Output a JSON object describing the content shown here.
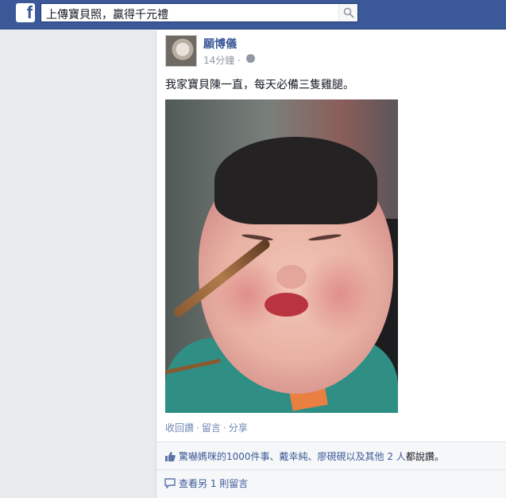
{
  "header": {
    "logo": "f",
    "search_value": "上傳寶貝照，贏得千元禮",
    "search_icon": "search-icon"
  },
  "post": {
    "author": "願博儀",
    "time": "14分鐘",
    "dot": "·",
    "message": "我家寶貝陳一直，每天必備三隻雞腿。",
    "actions": [
      "收回讚",
      "留言",
      "分享"
    ],
    "likes_text_prefix": "驚嚇媽咪的1000件事、戴幸純、廖硯硯以及其他 ",
    "likes_people": "2 人",
    "likes_text_suffix": "都說讚。",
    "comments_link": "查看另 1 則留言"
  },
  "colors": {
    "brand": "#3b5998",
    "link": "#6d84b4",
    "text": "#141823",
    "muted": "#9197a3"
  }
}
